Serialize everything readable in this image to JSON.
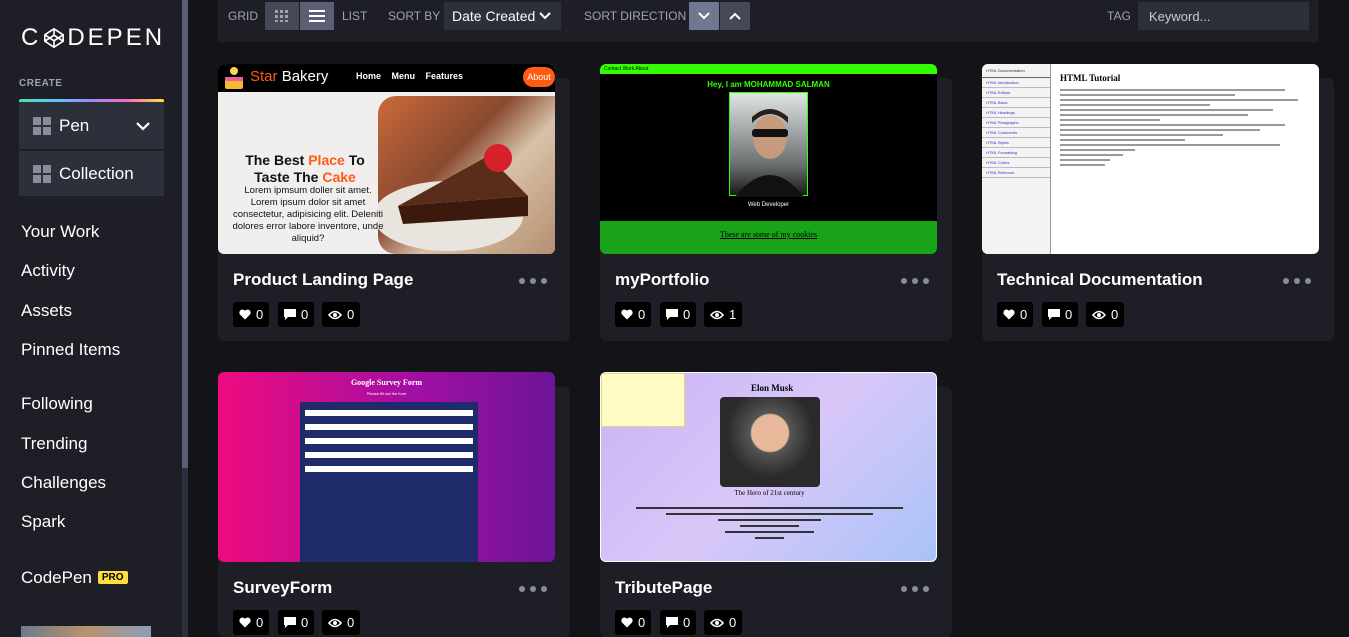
{
  "sidebar": {
    "logo": "CODEPEN",
    "create_label": "CREATE",
    "pen_label": "Pen",
    "collection_label": "Collection",
    "nav": [
      "Your Work",
      "Activity",
      "Assets",
      "Pinned Items",
      "Following",
      "Trending",
      "Challenges",
      "Spark",
      "CodePen"
    ],
    "pro_badge": "PRO"
  },
  "filterbar": {
    "grid_label": "GRID",
    "list_label": "LIST",
    "sort_by_label": "SORT BY",
    "sort_value": "Date Created",
    "sort_direction_label": "SORT DIRECTION",
    "tag_label": "TAG",
    "tag_placeholder": "Keyword..."
  },
  "cards": [
    {
      "title": "Product Landing Page",
      "likes": "0",
      "comments": "0",
      "views": "0",
      "preview": {
        "brand_a": "Star ",
        "brand_b": "Bakery",
        "links": "Home Menu Features",
        "about": "About",
        "headline_1": "The Best ",
        "headline_2": "Place",
        "headline_3": " To Taste The ",
        "headline_4": "Cake",
        "text": "Lorem ipmsum doller sit amet. Lorem ipsum dolor sit amet consectetur, adipisicing elit. Deleniti dolores error labore inventore, unde aliquid?"
      }
    },
    {
      "title": "myPortfolio",
      "likes": "0",
      "comments": "0",
      "views": "1",
      "preview": {
        "topbar": "Contact   Work   About",
        "hello": "Hey, I am MOHAMMAD SALMAN",
        "role": "Web Developer",
        "cookies": "These are some of my cookies"
      }
    },
    {
      "title": "Technical Documentation",
      "likes": "0",
      "comments": "0",
      "views": "0",
      "preview": {
        "heading": "HTML Tutorial",
        "side_title": "HTML Documentation",
        "side_items": [
          "HTML Introduction",
          "HTML Editors",
          "HTML Basic",
          "HTML Headings",
          "HTML Paragraphs",
          "HTML Comments",
          "HTML Styles",
          "HTML Formatting",
          "HTML Colors",
          "HTML Refrence"
        ]
      }
    },
    {
      "title": "SurveyForm",
      "likes": "0",
      "comments": "0",
      "views": "0",
      "preview": {
        "title": "Google Survey Form",
        "subtitle": "Please fill out the form"
      }
    },
    {
      "title": "TributePage",
      "likes": "0",
      "comments": "0",
      "views": "0",
      "preview": {
        "name": "Elon Musk",
        "hero": "The Hero of 21st century"
      }
    }
  ],
  "colors": {
    "bg": "#131417",
    "panel": "#1e1f26",
    "button": "#2c303a",
    "pro": "#ffdd40",
    "accent_orange": "#ff5b14",
    "portfolio_green": "#33ff00"
  }
}
